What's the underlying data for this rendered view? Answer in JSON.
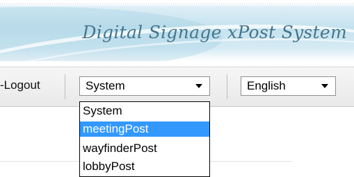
{
  "header": {
    "title": "Digital Signage xPost System"
  },
  "toolbar": {
    "logout_prefix": "-",
    "logout_label": "Logout",
    "system_select": {
      "selected": "System",
      "options": [
        "System",
        "meetingPost",
        "wayfinderPost",
        "lobbyPost"
      ],
      "highlighted": "meetingPost"
    },
    "language_select": {
      "selected": "English"
    }
  },
  "colors": {
    "title_text": "#46758c",
    "highlight": "#3399ff",
    "banner_light_blue": "#c4e2ee"
  }
}
